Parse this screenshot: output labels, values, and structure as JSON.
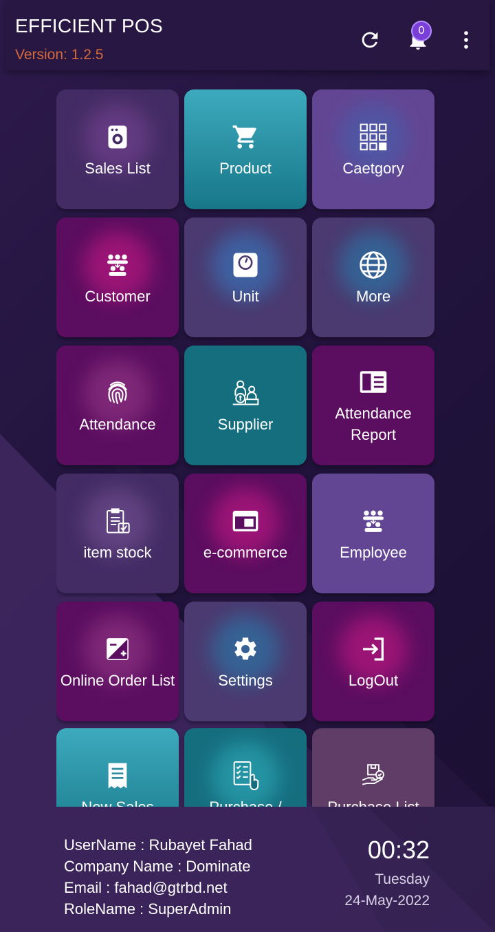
{
  "header": {
    "title": "EFFICIENT POS",
    "version": "Version: 1.2.5",
    "notification_count": "0",
    "icons": [
      "refresh-icon",
      "bell-icon",
      "more-vert-icon"
    ]
  },
  "tiles": [
    {
      "label": "Sales List",
      "icon": "receipt-icon"
    },
    {
      "label": "Product",
      "icon": "cart-icon"
    },
    {
      "label": "Caetgory",
      "icon": "grid-icon"
    },
    {
      "label": "Customer",
      "icon": "group-icon"
    },
    {
      "label": "Unit",
      "icon": "scale-icon"
    },
    {
      "label": "More",
      "icon": "globe-icon"
    },
    {
      "label": "Attendance",
      "icon": "fingerprint-icon"
    },
    {
      "label": "Supplier",
      "icon": "supplier-icon"
    },
    {
      "label": "Attendance Report",
      "icon": "report-icon"
    },
    {
      "label": "item stock",
      "icon": "clipboard-icon"
    },
    {
      "label": "e-commerce",
      "icon": "browser-icon"
    },
    {
      "label": "Employee",
      "icon": "group-icon"
    },
    {
      "label": "Online Order List",
      "icon": "edit-box-icon"
    },
    {
      "label": "Settings",
      "icon": "gear-icon"
    },
    {
      "label": "LogOut",
      "icon": "login-icon"
    },
    {
      "label": "New Sales",
      "icon": "bill-icon"
    },
    {
      "label": "Purchase /",
      "icon": "checklist-icon"
    },
    {
      "label": "Purchase List",
      "icon": "delivery-icon"
    }
  ],
  "user": {
    "username": "UserName : Rubayet Fahad",
    "company": "Company Name : Dominate",
    "email": "Email : fahad@gtrbd.net",
    "role": "RoleName : SuperAdmin"
  },
  "clock": {
    "time": "00:32",
    "day": "Tuesday",
    "date": "24-May-2022"
  },
  "colors": {
    "background": "#1c1034",
    "version_text": "#d56a3c",
    "badge": "#7a3fd6",
    "teal": "#177789",
    "magenta": "#5b0d5f",
    "violet": "#634693"
  }
}
